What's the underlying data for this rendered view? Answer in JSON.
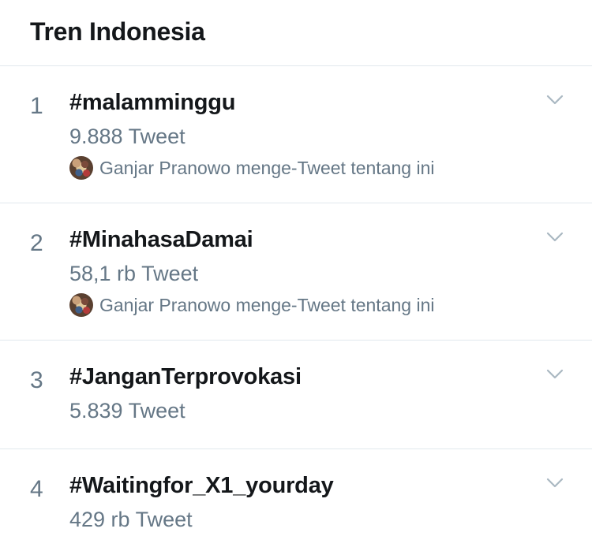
{
  "header": {
    "title": "Tren Indonesia"
  },
  "trends": [
    {
      "rank": "1",
      "hashtag": "#malamminggu",
      "count": "9.888 Tweet",
      "context": "Ganjar Pranowo menge-Tweet tentang ini"
    },
    {
      "rank": "2",
      "hashtag": "#MinahasaDamai",
      "count": "58,1 rb Tweet",
      "context": "Ganjar Pranowo menge-Tweet tentang ini"
    },
    {
      "rank": "3",
      "hashtag": "#JanganTerprovokasi",
      "count": "5.839 Tweet"
    },
    {
      "rank": "4",
      "hashtag": "#Waitingfor_X1_yourday",
      "count": "429 rb Tweet"
    }
  ],
  "icons": {
    "chevron": "chevron-down-icon",
    "avatar": "user-avatar"
  },
  "colors": {
    "primary_text": "#14171a",
    "secondary_text": "#657786",
    "divider": "#e1e8ed",
    "chevron": "#aab8c2"
  }
}
